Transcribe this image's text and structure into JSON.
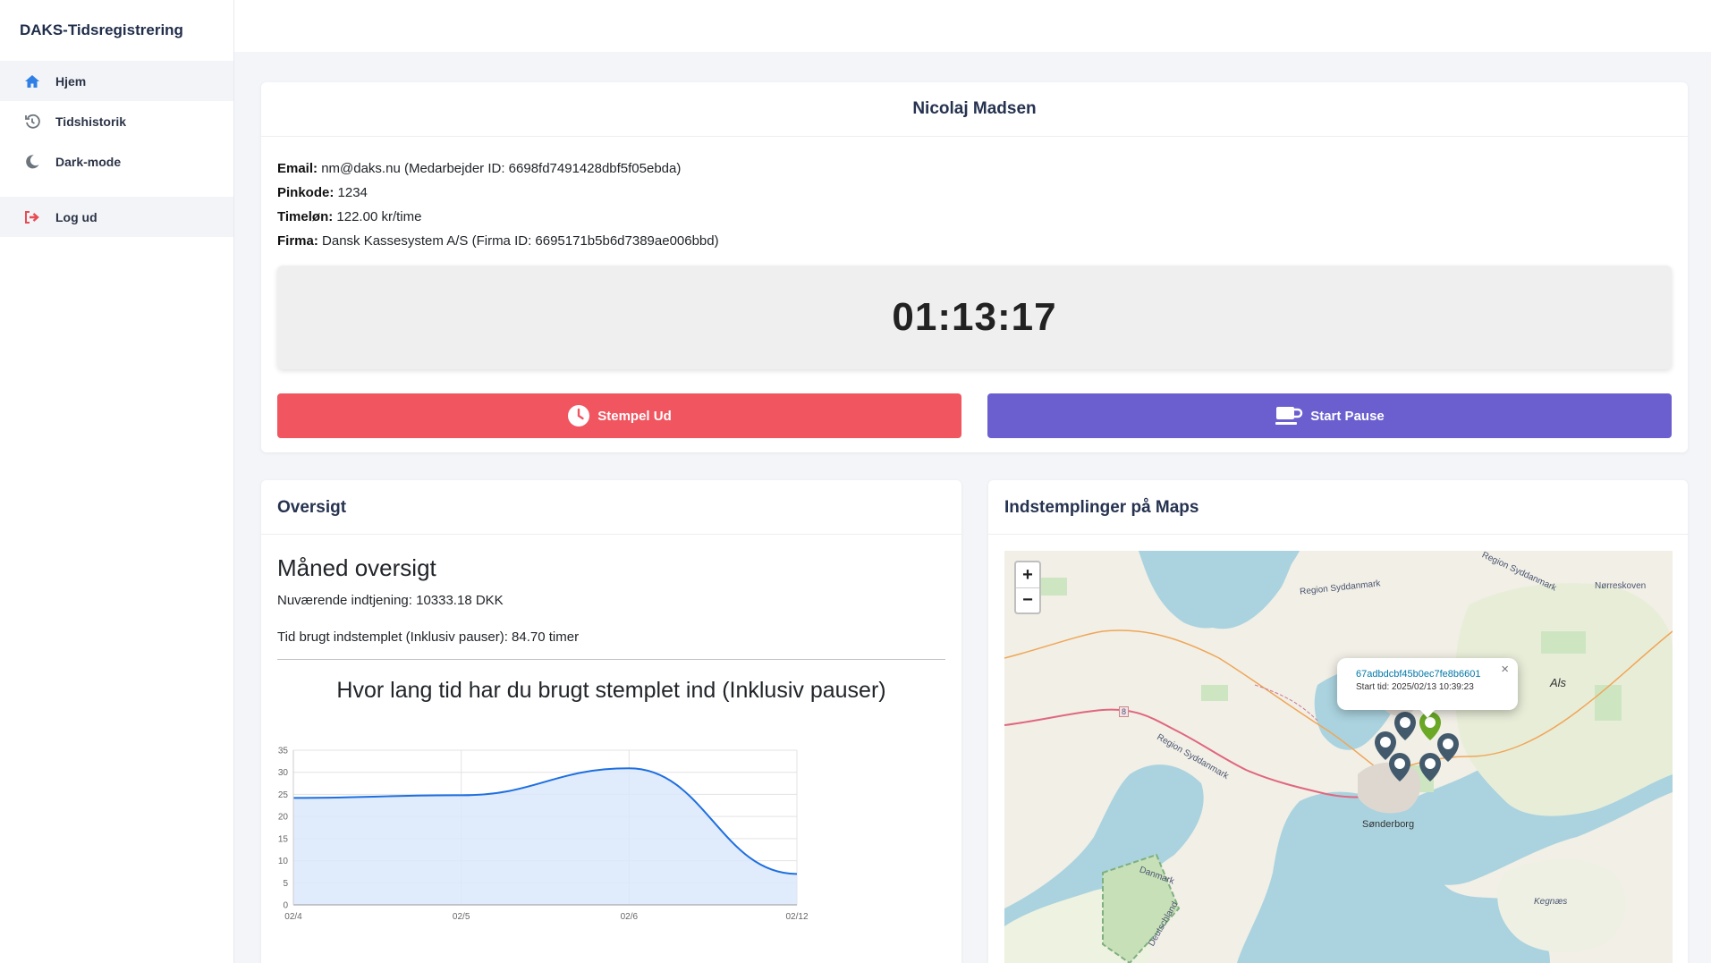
{
  "app": {
    "title": "DAKS-Tidsregistrering"
  },
  "sidebar": {
    "items": [
      {
        "label": "Hjem",
        "icon": "home-icon"
      },
      {
        "label": "Tidshistorik",
        "icon": "history-icon"
      },
      {
        "label": "Dark-mode",
        "icon": "moon-icon"
      }
    ],
    "logout": {
      "label": "Log ud",
      "icon": "logout-icon"
    }
  },
  "profile": {
    "name": "Nicolaj Madsen",
    "email_label": "Email:",
    "email_value": "nm@daks.nu (Medarbejder ID: 6698fd7491428dbf5f05ebda)",
    "pin_label": "Pinkode:",
    "pin_value": "1234",
    "wage_label": "Timeløn:",
    "wage_value": "122.00 kr/time",
    "company_label": "Firma:",
    "company_value": "Dansk Kassesystem A/S (Firma ID: 6695171b5b6d7389ae006bbd)",
    "timer": "01:13:17",
    "stamp_out_label": "Stempel Ud",
    "pause_label": "Start Pause"
  },
  "overview": {
    "heading": "Oversigt",
    "title": "Måned oversigt",
    "earnings": "Nuværende indtjening: 10333.18 DKK",
    "time_spent": "Tid brugt indstemplet (Inklusiv pauser): 84.70 timer"
  },
  "chart_data": {
    "type": "area",
    "title": "Hvor lang tid har du brugt stemplet ind (Inklusiv pauser)",
    "categories": [
      "02/4",
      "02/5",
      "02/6",
      "02/12"
    ],
    "values": [
      24.2,
      24.8,
      30.9,
      7.0
    ],
    "ylim": [
      0,
      35
    ],
    "yticks": [
      0,
      5,
      10,
      15,
      20,
      25,
      30,
      35
    ],
    "xlabel": "",
    "ylabel": "",
    "grid": true,
    "colors": {
      "line": "#1e6fe0",
      "fill": "#dbe8fb"
    }
  },
  "maps": {
    "heading": "Indstemplinger på Maps",
    "zoom_in": "+",
    "zoom_out": "−",
    "popup_id": "67adbdcbf45b0ec7fe8b6601",
    "popup_time": "Start tid: 2025/02/13 10:39:23",
    "labels": {
      "als": "Als",
      "sonderborg": "Sønderborg",
      "region1": "Region Syddanmark",
      "region2": "Region Syddanmark",
      "region3": "Region Syddanmark",
      "nordborg": "Nørreskoven",
      "kegnaes": "Kegnæs",
      "danmark": "Danmark",
      "deutschland": "Deutschland",
      "road8": "8"
    }
  }
}
